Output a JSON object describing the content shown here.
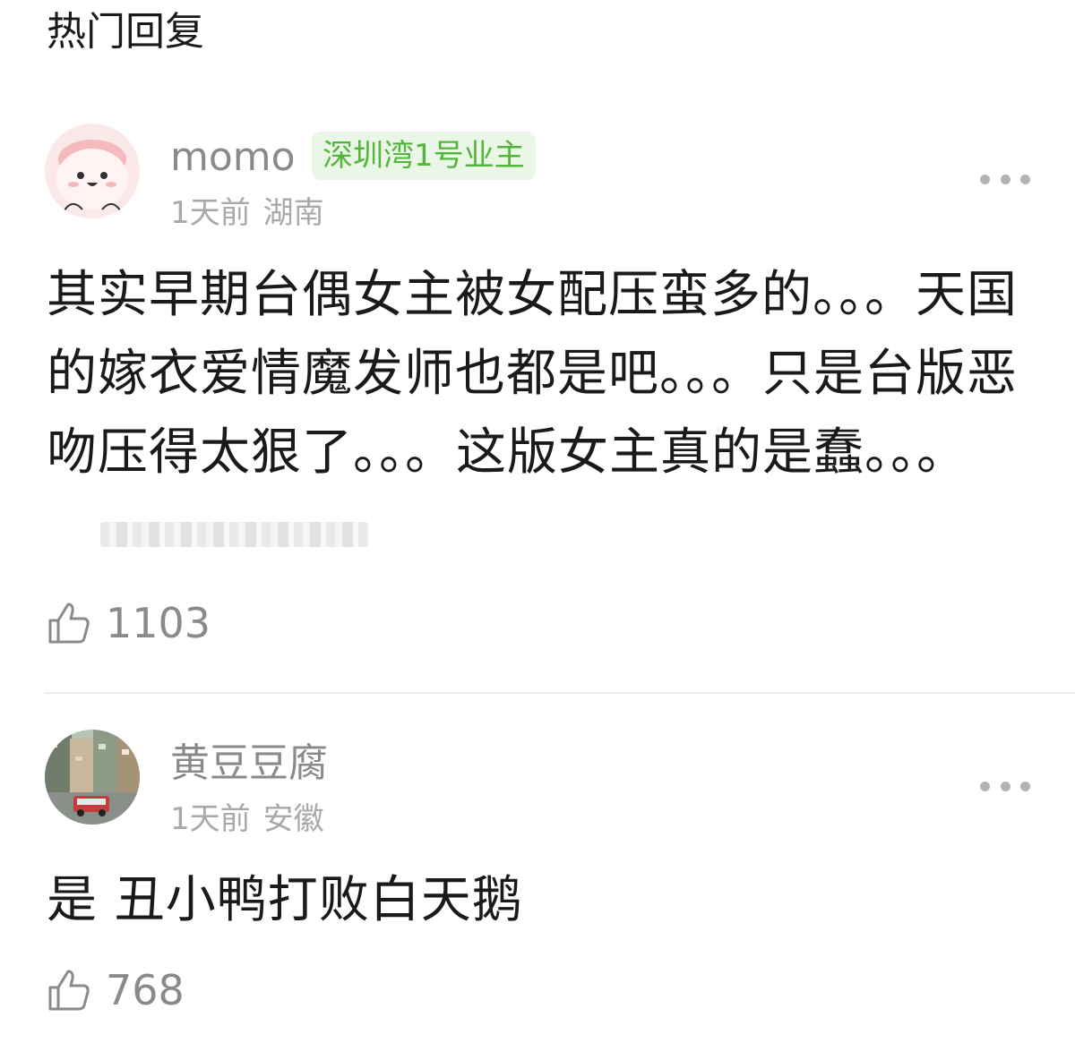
{
  "section": {
    "title": "热门回复"
  },
  "comments": [
    {
      "user": "momo",
      "badge": "深圳湾1号业主",
      "time": "1天前",
      "location": "湖南",
      "text": "其实早期台偶女主被女配压蛮多的。。。天国的嫁衣爱情魔发师也都是吧。。。只是台版恶吻压得太狠了。。。这版女主真的是蠢。。。",
      "likes": "1103",
      "avatar_icon": "cartoon-face-avatar",
      "more_icon": "more-dots-icon",
      "like_icon": "thumbs-up-icon"
    },
    {
      "user": "黄豆豆腐",
      "time": "1天前",
      "location": "安徽",
      "text": "是 丑小鸭打败白天鹅",
      "likes": "768",
      "avatar_icon": "street-photo-avatar",
      "more_icon": "more-dots-icon",
      "like_icon": "thumbs-up-icon"
    }
  ],
  "colors": {
    "badge_text": "#52b63c",
    "badge_bg": "#eaf7e6",
    "muted": "#8a8a8a"
  }
}
